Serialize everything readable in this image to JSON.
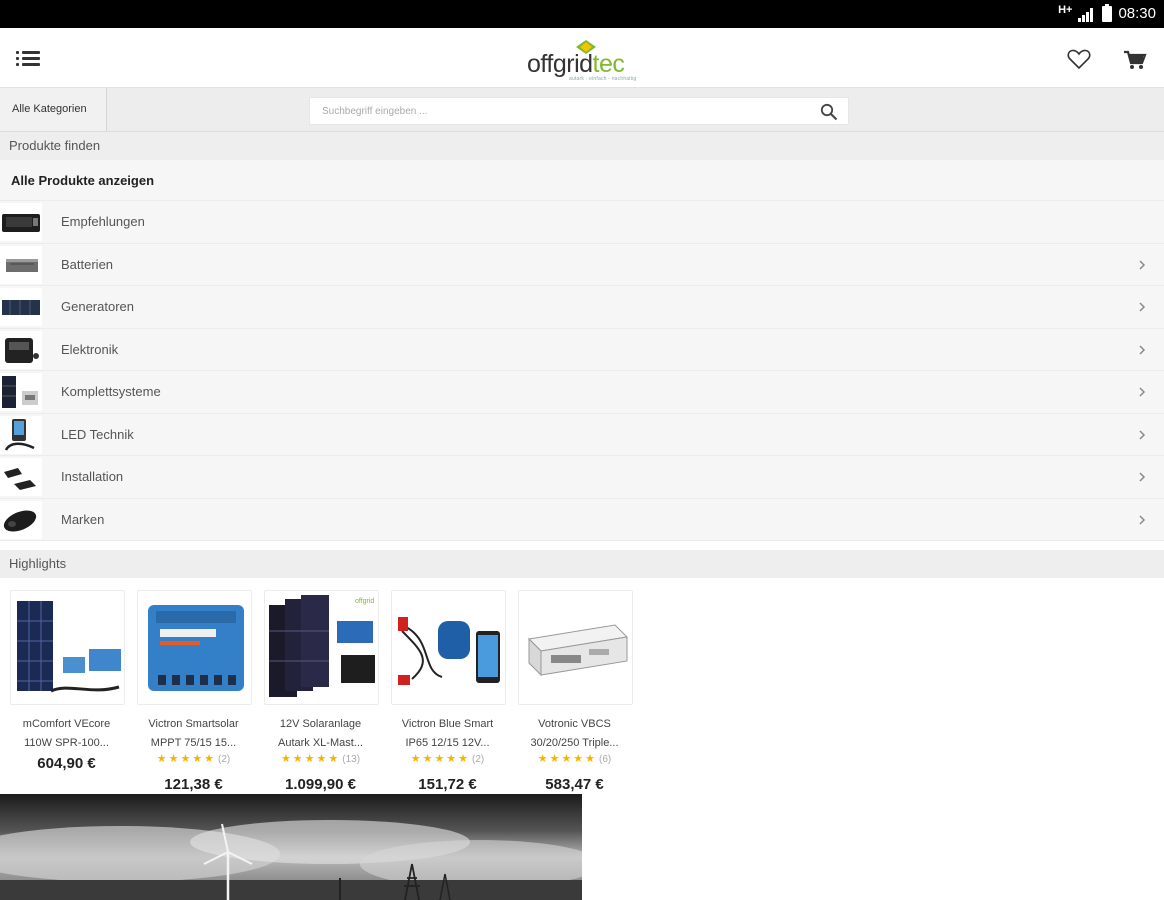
{
  "status_bar": {
    "network": "H+",
    "time": "08:30"
  },
  "header": {
    "logo_text_a": "offgrid",
    "logo_text_b": "tec",
    "logo_tagline": "autark - einfach - nachhaltig"
  },
  "search": {
    "category_button": "Alle Kategorien",
    "placeholder": "Suchbegriff eingeben ..."
  },
  "find_products": {
    "title": "Produkte finden",
    "all_products": "Alle Produkte anzeigen",
    "categories": [
      {
        "label": "Empfehlungen",
        "has_arrow": false
      },
      {
        "label": "Batterien",
        "has_arrow": true
      },
      {
        "label": "Generatoren",
        "has_arrow": true
      },
      {
        "label": "Elektronik",
        "has_arrow": true
      },
      {
        "label": "Komplettsysteme",
        "has_arrow": true
      },
      {
        "label": "LED Technik",
        "has_arrow": true
      },
      {
        "label": "Installation",
        "has_arrow": true
      },
      {
        "label": "Marken",
        "has_arrow": true
      }
    ]
  },
  "highlights": {
    "title": "Highlights",
    "products": [
      {
        "name_1": "mComfort VEcore",
        "name_2": "110W SPR-100...",
        "stars": "",
        "reviews": "",
        "price": "604,90 €"
      },
      {
        "name_1": "Victron Smartsolar",
        "name_2": "MPPT 75/15 15...",
        "stars": "★★★★★",
        "reviews": "(2)",
        "price": "121,38 €"
      },
      {
        "name_1": "12V Solaranlage",
        "name_2": "Autark XL-Mast...",
        "stars": "★★★★★",
        "reviews": "(13)",
        "price": "1.099,90 €"
      },
      {
        "name_1": "Victron Blue Smart",
        "name_2": "IP65 12/15 12V...",
        "stars": "★★★★★",
        "reviews": "(2)",
        "price": "151,72 €"
      },
      {
        "name_1": "Votronic VBCS",
        "name_2": "30/20/250 Triple...",
        "stars": "★★★★★",
        "reviews": "(6)",
        "price": "583,47 €"
      }
    ]
  }
}
